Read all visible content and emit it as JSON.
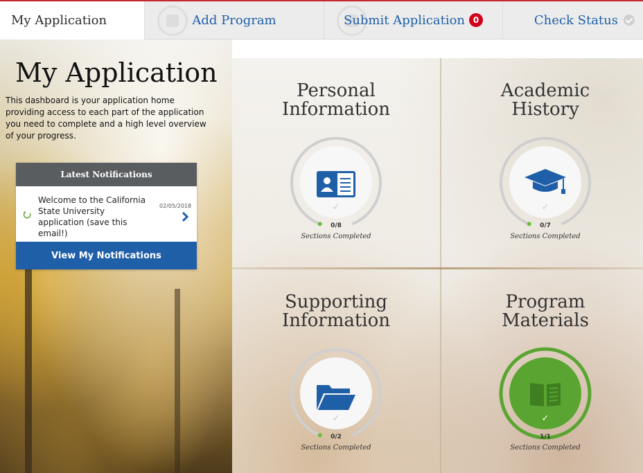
{
  "nav": {
    "tabs": [
      {
        "label": "My Application"
      },
      {
        "label": "Add Program"
      },
      {
        "label": "Submit Application",
        "badge": "0"
      },
      {
        "label": "Check Status"
      }
    ]
  },
  "sidebar": {
    "title": "My Application",
    "intro": "This dashboard is your application home providing access to each part of the application you need to complete and a high level overview of your progress.",
    "notifications": {
      "header": "Latest Notifications",
      "item": {
        "text": "Welcome to the California State University application (save this email!)",
        "date": "02/05/2018"
      },
      "button": "View My Notifications"
    }
  },
  "sections": [
    {
      "title_line1": "Personal",
      "title_line2": "Information",
      "icon": "id-card-icon",
      "count": "0/8",
      "caption": "Sections Completed",
      "progress": 0
    },
    {
      "title_line1": "Academic",
      "title_line2": "History",
      "icon": "graduation-cap-icon",
      "count": "0/7",
      "caption": "Sections Completed",
      "progress": 0
    },
    {
      "title_line1": "Supporting",
      "title_line2": "Information",
      "icon": "folder-icon",
      "count": "0/2",
      "caption": "Sections Completed",
      "progress": 0
    },
    {
      "title_line1": "Program",
      "title_line2": "Materials",
      "icon": "book-icon",
      "count": "1/1",
      "caption": "Sections Completed",
      "progress": 1
    }
  ],
  "colors": {
    "accent": "#1f5fa8",
    "brand_red": "#c1272d",
    "badge": "#d0021b",
    "complete_green": "#5aa532",
    "progress_dot": "#6abf3a"
  }
}
